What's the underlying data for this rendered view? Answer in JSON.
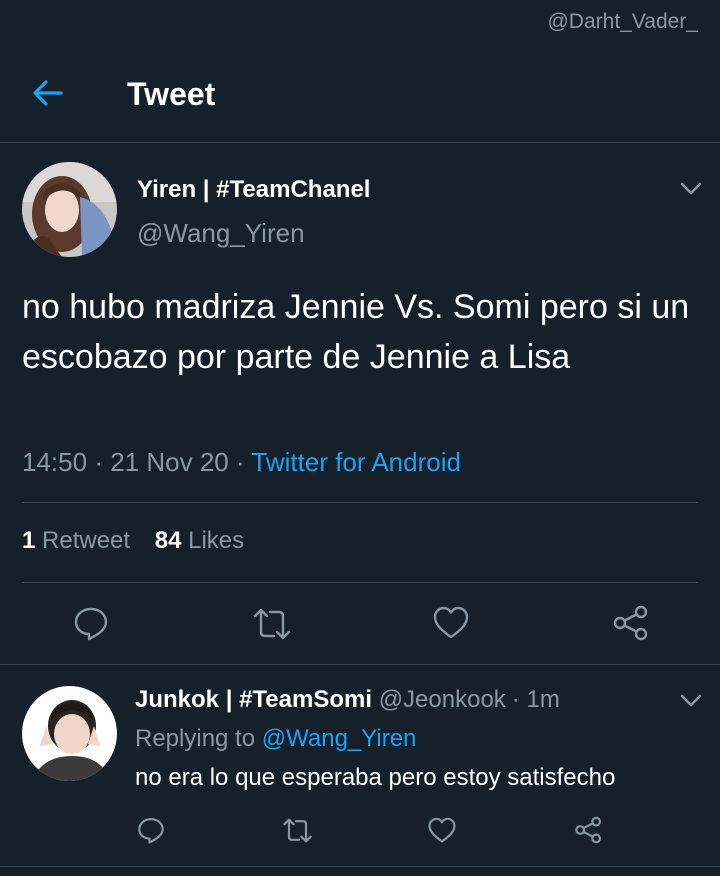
{
  "watermark": "@Darht_Vader_",
  "header": {
    "title": "Tweet"
  },
  "tweet": {
    "author_name": "Yiren | #TeamChanel",
    "author_handle": "@Wang_Yiren",
    "text": "no hubo madriza Jennie Vs. Somi pero si un escobazo por parte de Jennie a Lisa",
    "time": "14:50",
    "dot1": "·",
    "date": "21 Nov 20",
    "dot2": "·",
    "source": "Twitter for Android",
    "retweet_count": "1",
    "retweet_label": "Retweet",
    "like_count": "84",
    "like_label": "Likes"
  },
  "reply": {
    "author_name": "Junkok | #TeamSomi",
    "author_handle": "@Jeonkook",
    "dot": "·",
    "time": "1m",
    "replying_label": "Replying to",
    "replying_to": "@Wang_Yiren",
    "text": "no era lo que esperaba pero estoy satisfecho"
  },
  "icons": {
    "back": "arrow-left-icon",
    "more": "chevron-down-icon",
    "reply": "comment-icon",
    "retweet": "retweet-icon",
    "like": "heart-icon",
    "share": "share-icon"
  },
  "colors": {
    "background": "#15202b",
    "divider": "#38444d",
    "accent": "#1da1f2",
    "secondary_text": "#8899a6",
    "primary_text": "#ffffff"
  }
}
